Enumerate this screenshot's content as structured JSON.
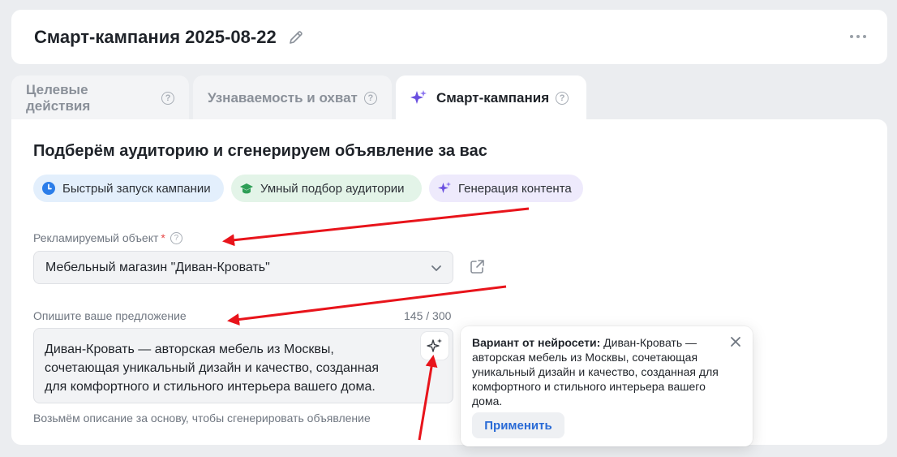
{
  "header": {
    "title": "Смарт-кампания 2025-08-22"
  },
  "tabs": [
    {
      "label": "Целевые действия",
      "active": false
    },
    {
      "label": "Узнаваемость и охват",
      "active": false
    },
    {
      "label": "Смарт-кампания",
      "active": true
    }
  ],
  "main": {
    "headline": "Подберём аудиторию и сгенерируем объявление за вас",
    "chips": [
      {
        "label": "Быстрый запуск кампании",
        "icon": "clock-icon",
        "color": "#e3effc"
      },
      {
        "label": "Умный подбор аудитории",
        "icon": "graduation-cap-icon",
        "color": "#e3f4e8"
      },
      {
        "label": "Генерация контента",
        "icon": "sparkles-icon",
        "color": "#eeeafc"
      }
    ],
    "object_field": {
      "label": "Рекламируемый объект",
      "required_mark": "*",
      "value": "Мебельный магазин \"Диван-Кровать\""
    },
    "offer_field": {
      "label": "Опишите ваше предложение",
      "counter": "145 / 300",
      "value": "Диван-Кровать — авторская мебель из Москвы, сочетающая уникальный дизайн и качество, созданная для комфортного и стильного интерьера вашего дома.",
      "hint": "Возьмём описание за основу, чтобы сгенерировать объявление"
    }
  },
  "popover": {
    "prefix": "Вариант от нейросети:",
    "text": " Диван-Кровать — авторская мебель из Москвы, сочетающая уникальный дизайн и качество, созданная для комфортного и стильного интерьера вашего дома.",
    "apply_label": "Применить"
  },
  "colors": {
    "accent_blue": "#2a6bd6",
    "sparkle_purple": "#6a4fe0",
    "annotation_red": "#e8141b"
  }
}
